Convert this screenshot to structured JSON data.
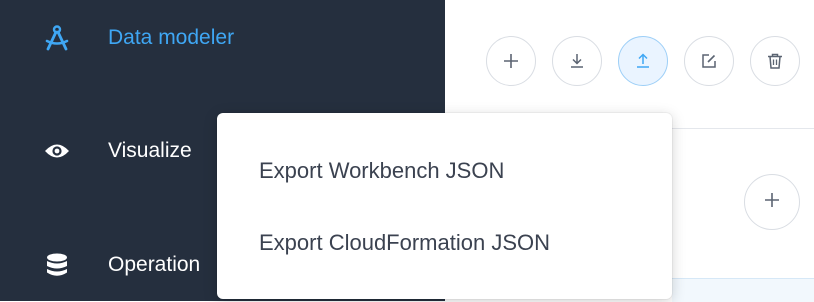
{
  "sidebar": {
    "items": [
      {
        "label": "Data modeler",
        "icon": "compass-icon",
        "active": true
      },
      {
        "label": "Visualize",
        "icon": "eye-icon"
      },
      {
        "label": "Operation",
        "icon": "database-icon"
      }
    ]
  },
  "toolbar": {
    "buttons": [
      {
        "name": "add",
        "icon": "plus-icon"
      },
      {
        "name": "import",
        "icon": "download-icon"
      },
      {
        "name": "export",
        "icon": "upload-icon",
        "active": true
      },
      {
        "name": "edit",
        "icon": "edit-icon"
      },
      {
        "name": "delete",
        "icon": "trash-icon"
      }
    ]
  },
  "export_menu": {
    "items": [
      {
        "label": "Export Workbench JSON"
      },
      {
        "label": "Export CloudFormation JSON"
      }
    ]
  },
  "colors": {
    "sidebar_bg": "#252f3e",
    "accent": "#3fa7f4",
    "menu_text": "#3b4250"
  }
}
